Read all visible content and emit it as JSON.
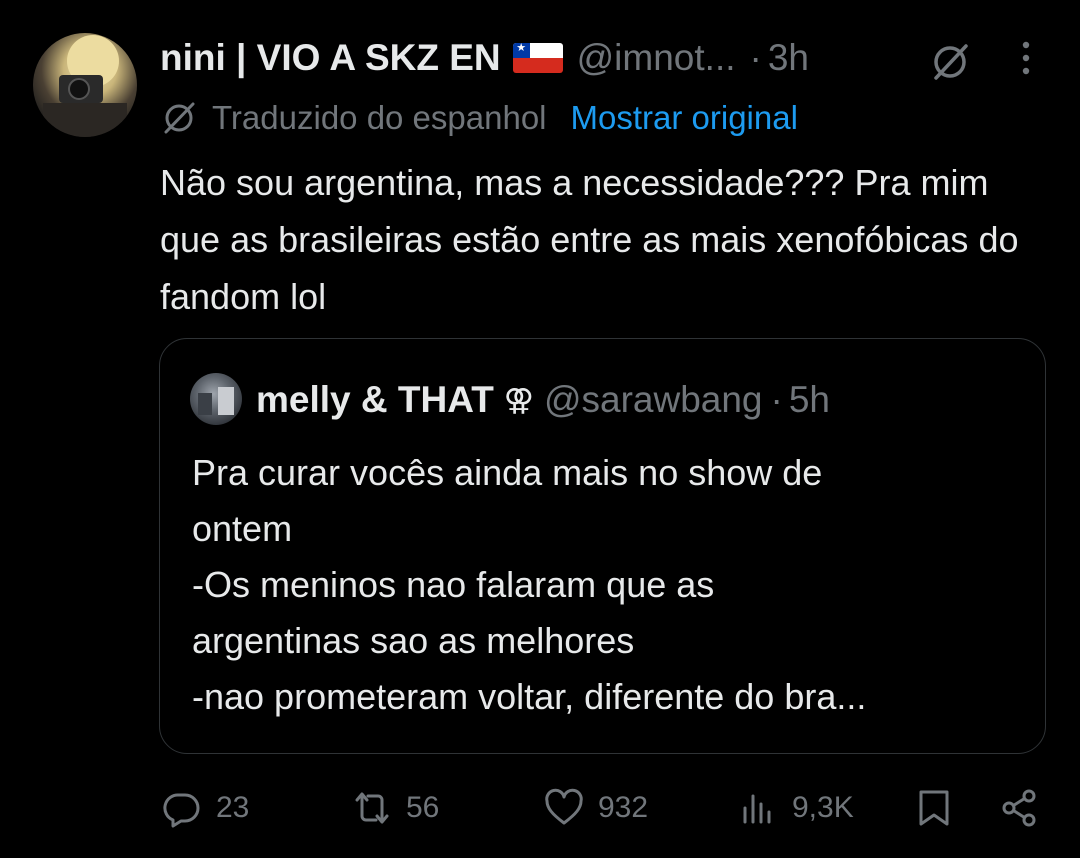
{
  "tweet": {
    "author": {
      "display_name": "nini | VIO A SKZ EN",
      "flag": "chile-flag",
      "handle": "@imnot...",
      "time": "3h"
    },
    "translation": {
      "label": "Traduzido do espanhol",
      "link": "Mostrar original"
    },
    "text": "Não sou argentina, mas a necessidade??? Pra mim que as brasileiras estão entre as mais xenofóbicas do fandom lol",
    "quote": {
      "display_name": "melly & THAT",
      "symbol": "⚢",
      "handle": "@sarawbang",
      "time": "5h",
      "lines": [
        "Pra curar vocês ainda mais no show de",
        "ontem",
        "-Os meninos nao falaram que as",
        "argentinas sao as melhores",
        "-nao prometeram voltar, diferente do bra..."
      ]
    },
    "actions": {
      "replies": "23",
      "retweets": "56",
      "likes": "932",
      "views": "9,3K"
    },
    "separator": "·",
    "colors": {
      "background": "#000000",
      "text": "#e7e9ea",
      "muted": "#71767b",
      "link": "#1d9bf0",
      "border": "#2f3336"
    }
  }
}
